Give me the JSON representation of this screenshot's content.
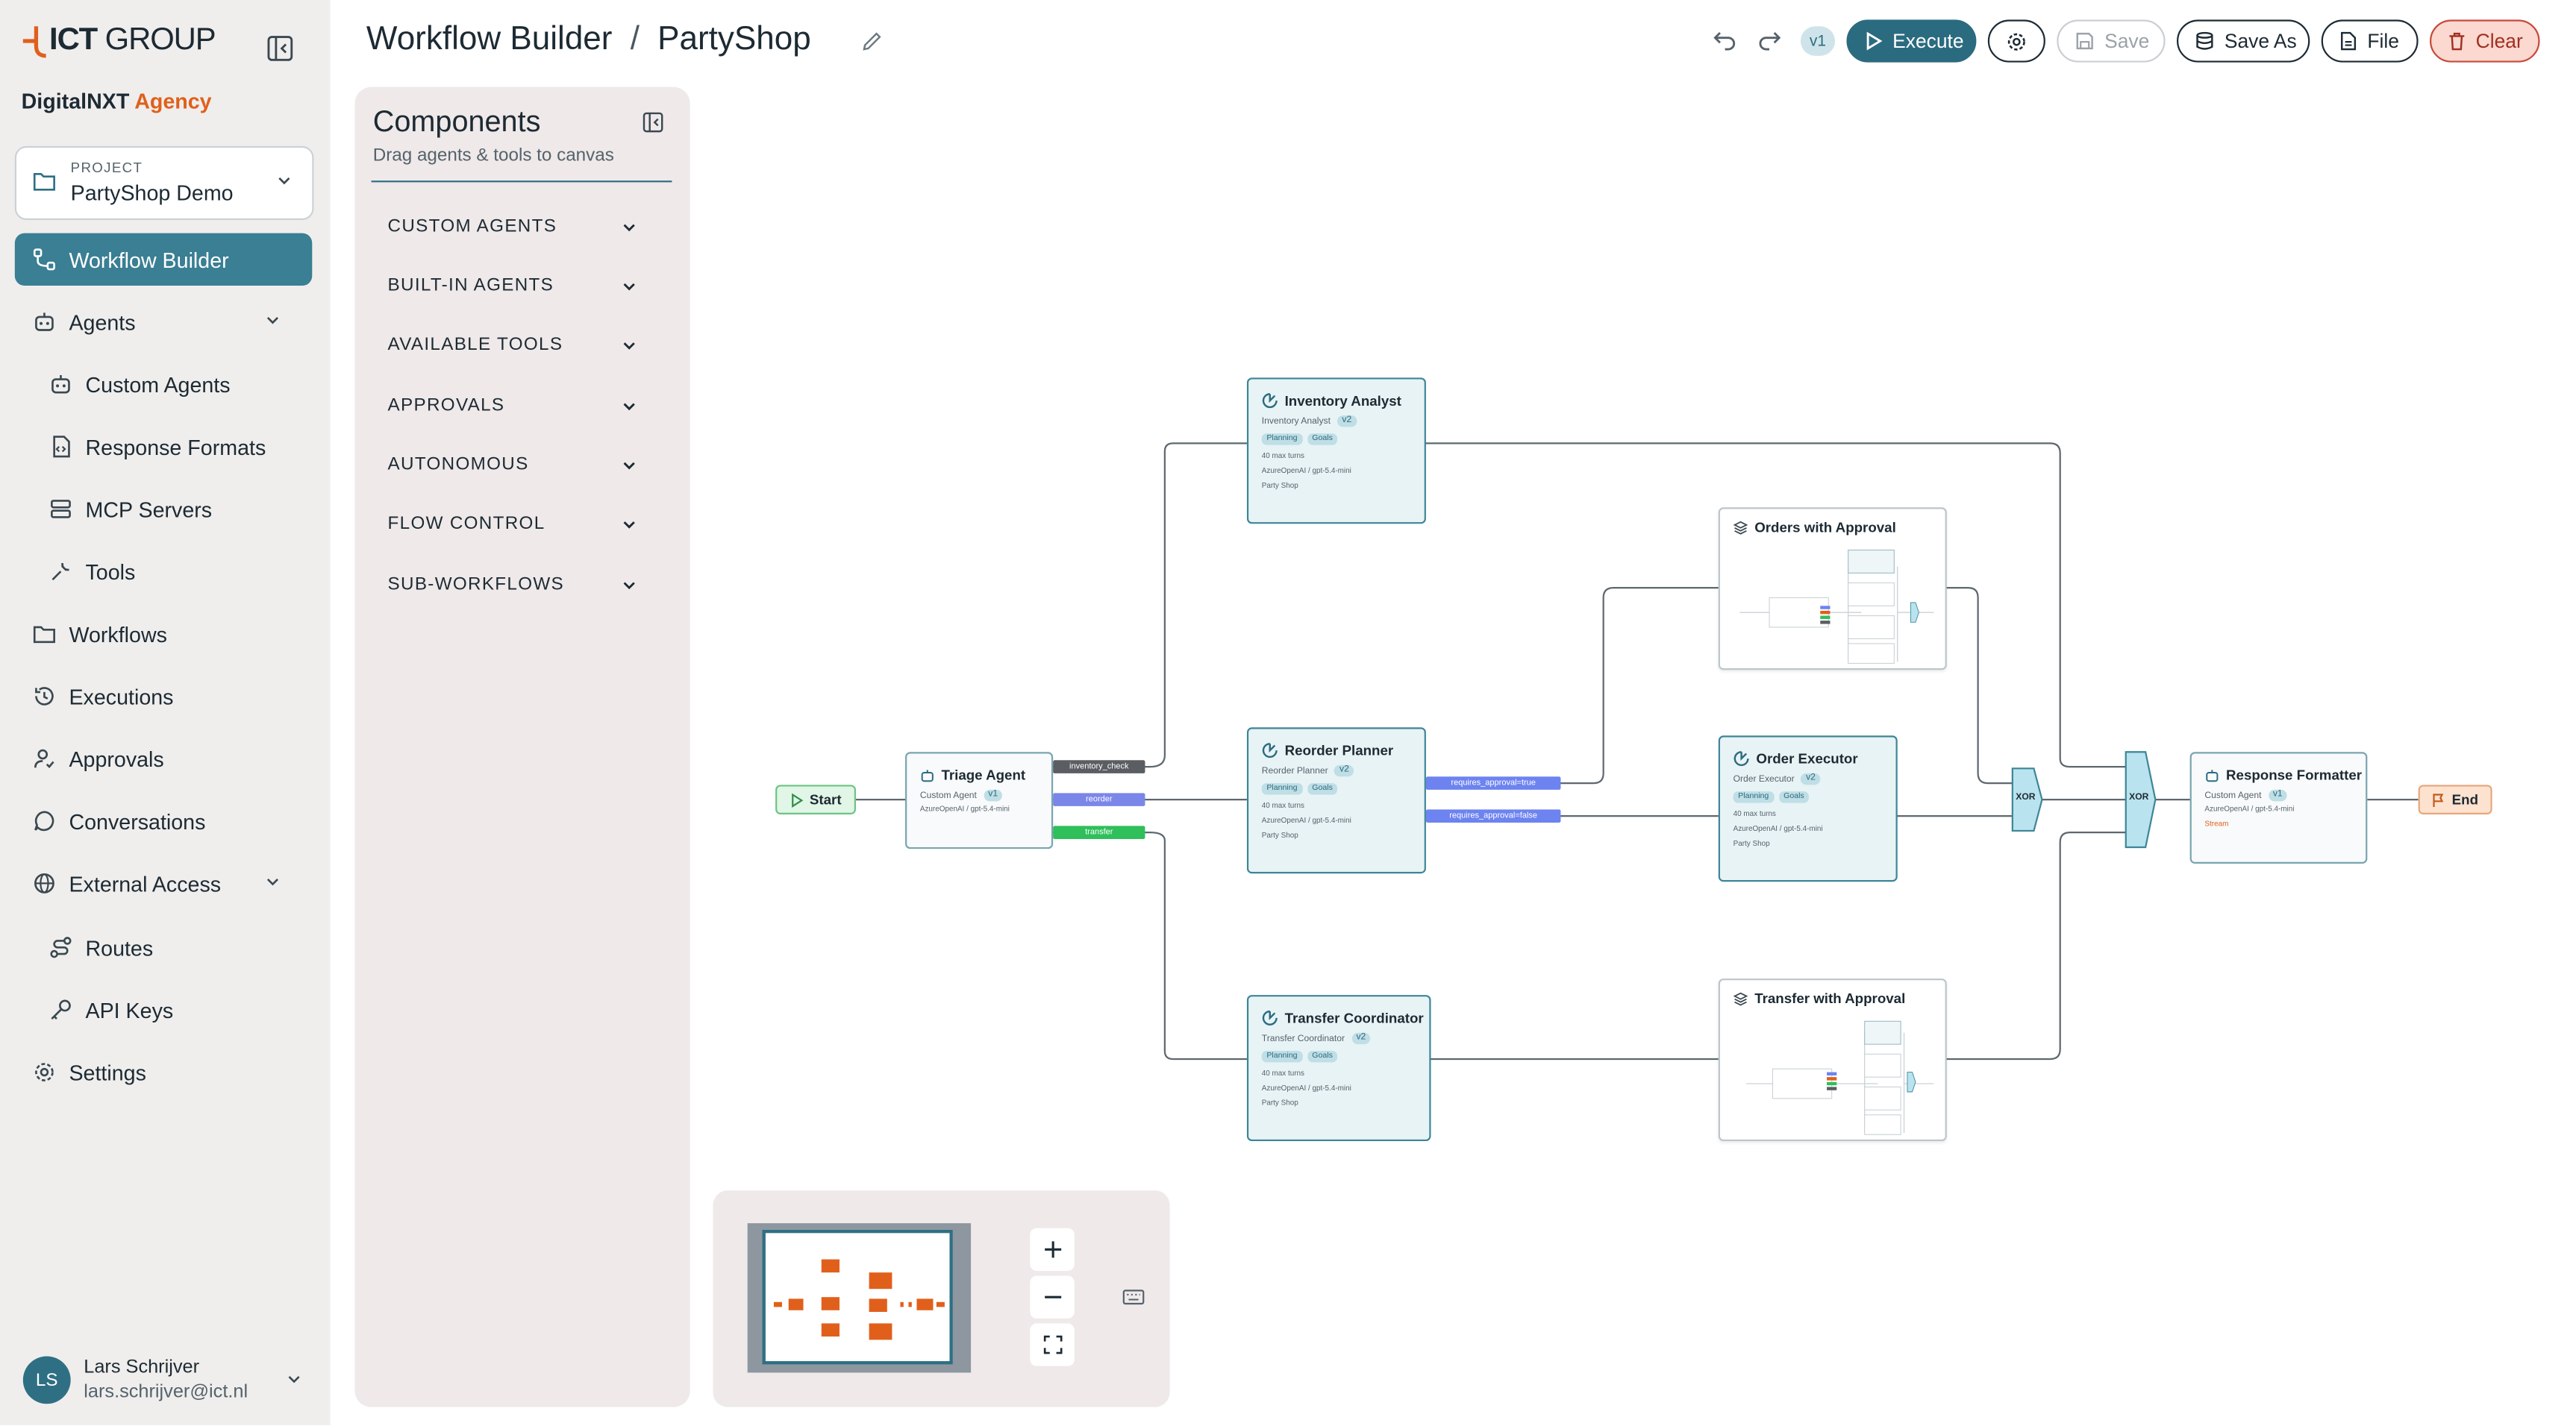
{
  "brand": {
    "logo_text": "ICT",
    "logo_group": " GROUP",
    "sub_prefix": "DigitalNXT ",
    "sub_accent": "Agency"
  },
  "project": {
    "label": "PROJECT",
    "value": "PartyShop Demo"
  },
  "nav": {
    "workflow_builder": "Workflow Builder",
    "agents": "Agents",
    "custom_agents": "Custom Agents",
    "response_formats": "Response Formats",
    "mcp_servers": "MCP Servers",
    "tools": "Tools",
    "workflows": "Workflows",
    "executions": "Executions",
    "approvals": "Approvals",
    "conversations": "Conversations",
    "external_access": "External Access",
    "routes": "Routes",
    "api_keys": "API Keys",
    "settings": "Settings"
  },
  "user": {
    "initials": "LS",
    "name": "Lars Schrijver",
    "email": "lars.schrijver@ict.nl"
  },
  "header": {
    "title": "Workflow Builder",
    "separator": "/",
    "workflow_name": "PartyShop",
    "version": "v1",
    "execute": "Execute",
    "save": "Save",
    "save_as": "Save As",
    "file": "File",
    "clear": "Clear"
  },
  "components": {
    "title": "Components",
    "subtitle": "Drag agents & tools to canvas",
    "categories": [
      "CUSTOM AGENTS",
      "BUILT-IN AGENTS",
      "AVAILABLE TOOLS",
      "APPROVALS",
      "AUTONOMOUS",
      "FLOW CONTROL",
      "SUB-WORKFLOWS"
    ]
  },
  "canvas": {
    "start": "Start",
    "end": "End",
    "xor": "XOR",
    "triage": {
      "title": "Triage Agent",
      "sub": "Custom Agent",
      "ver": "v1",
      "model": "AzureOpenAI / gpt-5.4-mini"
    },
    "inventory": {
      "title": "Inventory Analyst",
      "sub": "Inventory Analyst",
      "ver": "v2",
      "tag1": "Planning",
      "tag2": "Goals",
      "turns": "40 max turns",
      "model": "AzureOpenAI / gpt-5.4-mini",
      "shop": "Party Shop"
    },
    "reorder": {
      "title": "Reorder Planner",
      "sub": "Reorder Planner",
      "ver": "v2",
      "tag1": "Planning",
      "tag2": "Goals",
      "turns": "40 max turns",
      "model": "AzureOpenAI / gpt-5.4-mini",
      "shop": "Party Shop"
    },
    "transfer": {
      "title": "Transfer Coordinator",
      "sub": "Transfer Coordinator",
      "ver": "v2",
      "tag1": "Planning",
      "tag2": "Goals",
      "turns": "40 max turns",
      "model": "AzureOpenAI / gpt-5.4-mini",
      "shop": "Party Shop"
    },
    "order_exec": {
      "title": "Order Executor",
      "sub": "Order Executor",
      "ver": "v2",
      "tag1": "Planning",
      "tag2": "Goals",
      "turns": "40 max turns",
      "model": "AzureOpenAI / gpt-5.4-mini",
      "shop": "Party Shop"
    },
    "formatter": {
      "title": "Response Formatter",
      "sub": "Custom Agent",
      "ver": "v1",
      "model": "AzureOpenAI / gpt-5.4-mini",
      "stream": "Stream"
    },
    "orders_approval": "Orders with Approval",
    "transfer_approval": "Transfer with Approval",
    "edge_inventory": "inventory_check",
    "edge_reorder": "reorder",
    "edge_transfer": "transfer",
    "edge_true": "requires_approval=true",
    "edge_false": "requires_approval=false",
    "colors": {
      "inventory_check": "#5a5d61",
      "reorder": "#7a86e8",
      "transfer": "#2fbf5b",
      "approval": "#6d83f0"
    }
  }
}
